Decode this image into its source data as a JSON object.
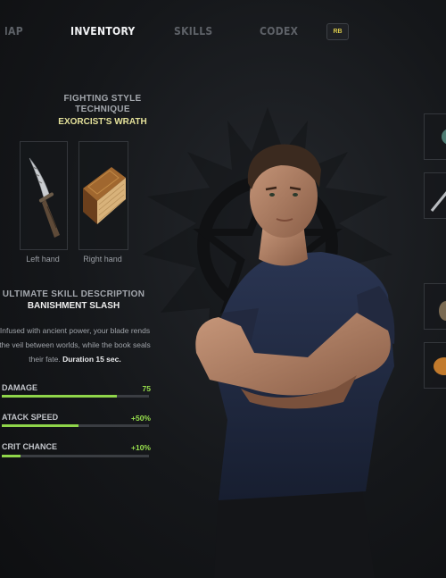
{
  "nav": {
    "tabs": [
      {
        "label": "MAP",
        "active": false
      },
      {
        "label": "INVENTORY",
        "active": true
      },
      {
        "label": "SKILLS",
        "active": false
      },
      {
        "label": "CODEX",
        "active": false
      }
    ],
    "button_hint": "RB"
  },
  "technique": {
    "label_line1": "FIGHTING STYLE",
    "label_line2": "TECHNIQUE",
    "name": "EXORCIST'S WRATH",
    "left_hand": {
      "caption": "Left hand",
      "item_icon": "dagger-icon"
    },
    "right_hand": {
      "caption": "Right hand",
      "item_icon": "tome-icon"
    }
  },
  "ultimate": {
    "label": "ULTIMATE SKILL DESCRIPTION",
    "name": "BANISHMENT SLASH",
    "desc_line1": "Infused with ancient power, your blade rends",
    "desc_line2": "the veil between worlds, while the book seals",
    "desc_line3": "their fate.",
    "desc_duration": "Duration 15 sec."
  },
  "stats": [
    {
      "label": "DAMAGE",
      "value": "75",
      "fill": 0.78
    },
    {
      "label": "ATACK SPEED",
      "value": "+50%",
      "fill": 0.52
    },
    {
      "label": "CRIT CHANCE",
      "value": "+10%",
      "fill": 0.13
    }
  ],
  "colors": {
    "accent_green": "#8fd54a",
    "title_yellow": "#e4e19a",
    "background": "#15171a"
  }
}
